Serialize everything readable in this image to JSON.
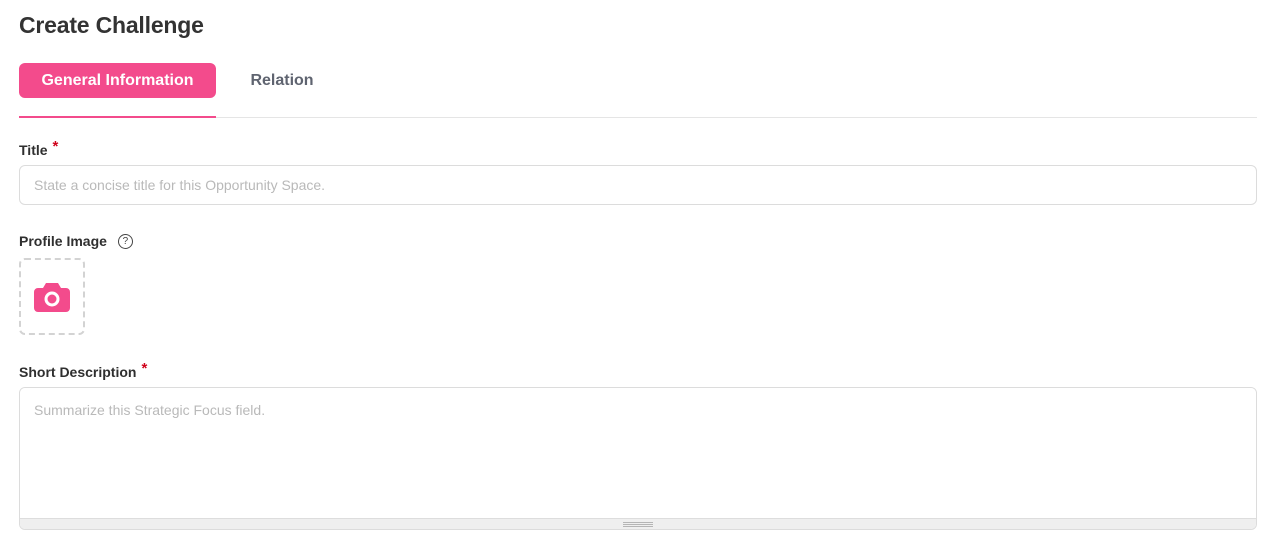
{
  "page": {
    "title": "Create Challenge"
  },
  "tabs": {
    "general": {
      "label": "General Information",
      "active": true
    },
    "relation": {
      "label": "Relation",
      "active": false
    }
  },
  "form": {
    "title": {
      "label": "Title",
      "required_marker": "*",
      "placeholder": "State a concise title for this Opportunity Space.",
      "value": ""
    },
    "profile_image": {
      "label": "Profile Image",
      "help_icon": "question-circle-icon",
      "help_glyph": "?",
      "upload_icon": "camera-icon"
    },
    "short_description": {
      "label": "Short Description",
      "required_marker": "*",
      "placeholder": "Summarize this Strategic Focus field.",
      "value": ""
    }
  },
  "colors": {
    "accent": "#f34b8c",
    "required": "#d0021b",
    "inactive_tab": "#5f6470"
  }
}
